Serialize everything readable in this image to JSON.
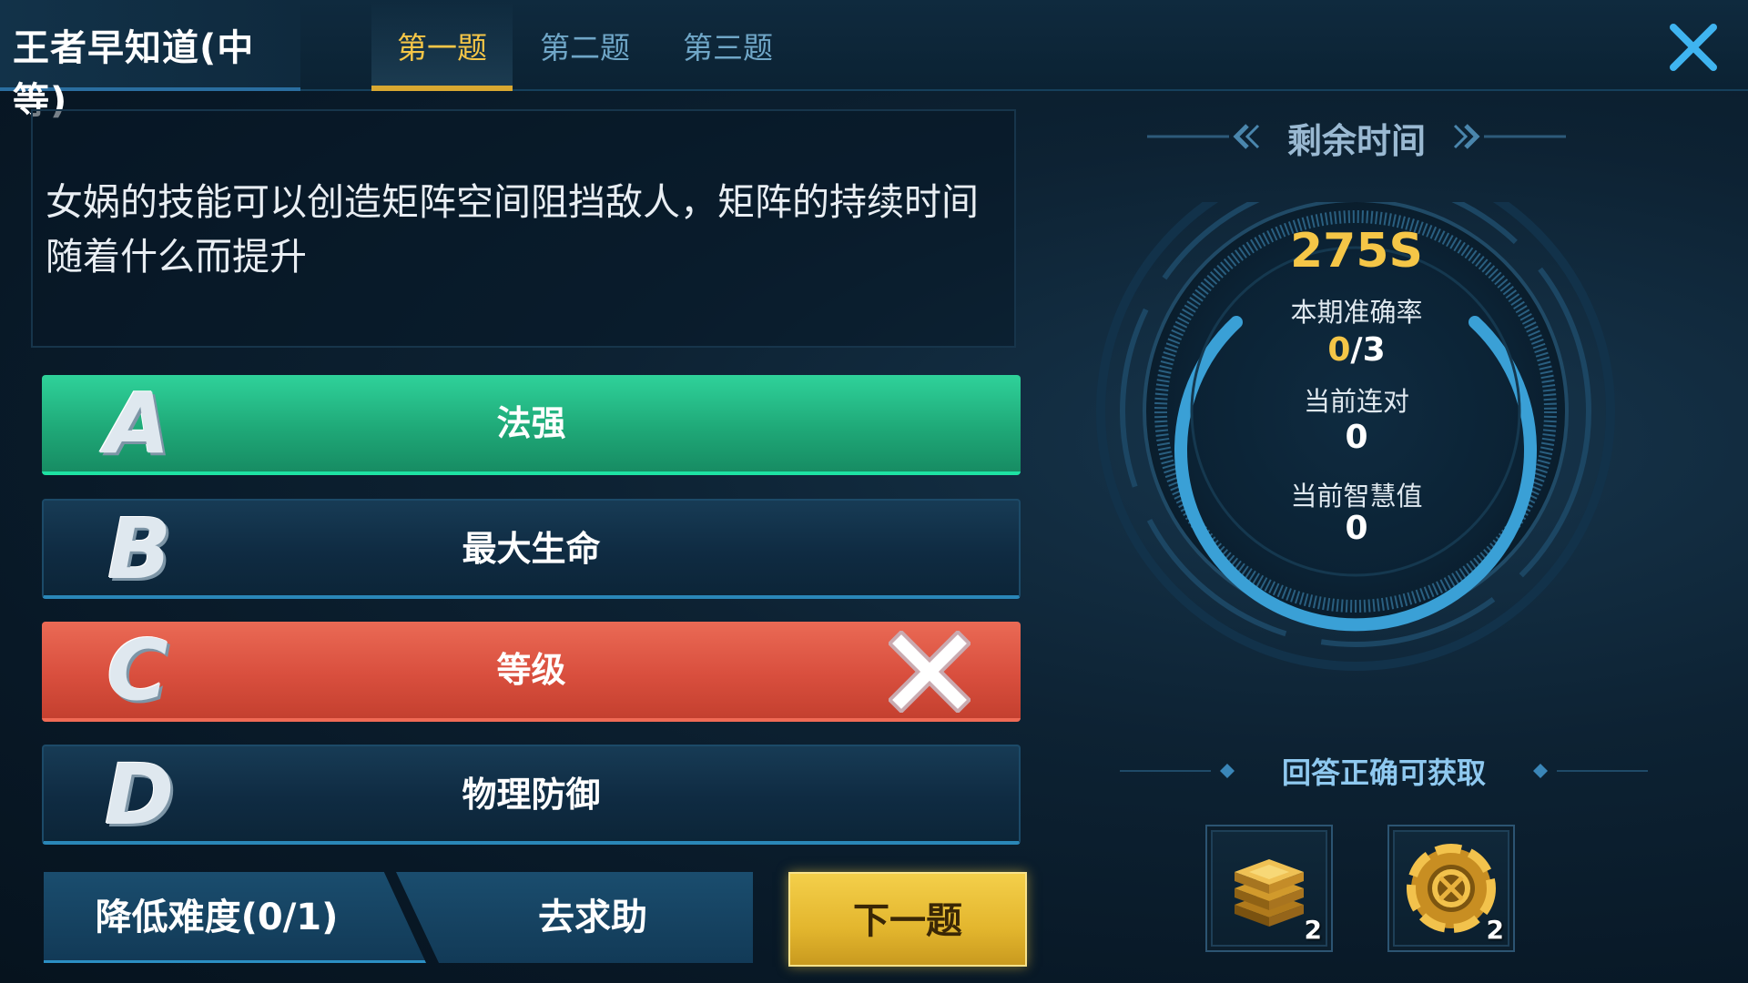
{
  "header": {
    "title": "王者早知道(中等)",
    "tabs": [
      {
        "label": "第一题",
        "active": true
      },
      {
        "label": "第二题",
        "active": false
      },
      {
        "label": "第三题",
        "active": false
      }
    ],
    "close_icon": "close-icon"
  },
  "question": {
    "text": "女娲的技能可以创造矩阵空间阻挡敌人，矩阵的持续时间随着什么而提升"
  },
  "options": [
    {
      "letter": "A",
      "label": "法强",
      "state": "correct"
    },
    {
      "letter": "B",
      "label": "最大生命",
      "state": "neutral"
    },
    {
      "letter": "C",
      "label": "等级",
      "state": "wrong"
    },
    {
      "letter": "D",
      "label": "物理防御",
      "state": "neutral"
    }
  ],
  "buttons": {
    "reduce_difficulty": "降低难度(0/1)",
    "ask_help": "去求助",
    "next": "下一题"
  },
  "timer": {
    "title": "剩余时间",
    "value": "275S",
    "accuracy_label": "本期准确率",
    "accuracy_correct": "0",
    "accuracy_total": "/3",
    "streak_label": "当前连对",
    "streak_value": "0",
    "wisdom_label": "当前智慧值",
    "wisdom_value": "0"
  },
  "rewards": {
    "title": "回答正确可获取",
    "items": [
      {
        "icon": "gold-stack-icon",
        "count": "2"
      },
      {
        "icon": "gear-coin-icon",
        "count": "2"
      }
    ]
  },
  "colors": {
    "accent_gold": "#f5c647",
    "correct_green": "#1fa978",
    "wrong_red": "#d94f3e",
    "neutral_blue": "#0f2b42",
    "ring_blue": "#3aa0d6"
  }
}
